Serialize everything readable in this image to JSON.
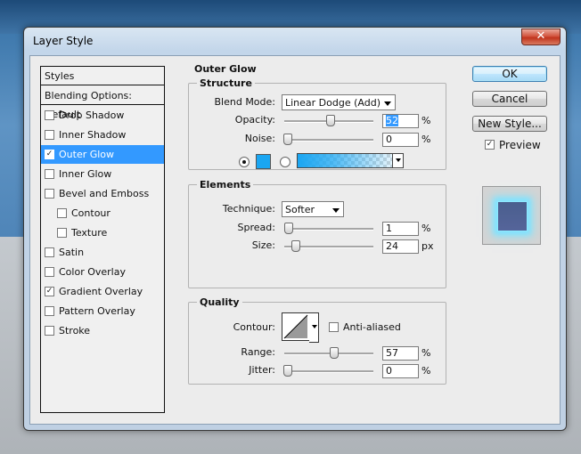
{
  "window": {
    "title": "Layer Style",
    "close_glyph": "✕"
  },
  "styles_list": {
    "header": "Styles",
    "blending_options": "Blending Options: Default",
    "items": [
      {
        "label": "Drop Shadow",
        "checked": false,
        "selected": false,
        "indent": false
      },
      {
        "label": "Inner Shadow",
        "checked": false,
        "selected": false,
        "indent": false
      },
      {
        "label": "Outer Glow",
        "checked": true,
        "selected": true,
        "indent": false
      },
      {
        "label": "Inner Glow",
        "checked": false,
        "selected": false,
        "indent": false
      },
      {
        "label": "Bevel and Emboss",
        "checked": false,
        "selected": false,
        "indent": false
      },
      {
        "label": "Contour",
        "checked": false,
        "selected": false,
        "indent": true
      },
      {
        "label": "Texture",
        "checked": false,
        "selected": false,
        "indent": true
      },
      {
        "label": "Satin",
        "checked": false,
        "selected": false,
        "indent": false
      },
      {
        "label": "Color Overlay",
        "checked": false,
        "selected": false,
        "indent": false
      },
      {
        "label": "Gradient Overlay",
        "checked": true,
        "selected": false,
        "indent": false
      },
      {
        "label": "Pattern Overlay",
        "checked": false,
        "selected": false,
        "indent": false
      },
      {
        "label": "Stroke",
        "checked": false,
        "selected": false,
        "indent": false
      }
    ]
  },
  "outer_glow": {
    "title": "Outer Glow",
    "structure": {
      "title": "Structure",
      "blend_mode_label": "Blend Mode:",
      "blend_mode_value": "Linear Dodge (Add)",
      "opacity_label": "Opacity:",
      "opacity_value": "52",
      "opacity_unit": "%",
      "noise_label": "Noise:",
      "noise_value": "0",
      "noise_unit": "%",
      "color_swatch": "#1aa6f2",
      "color_radio_selected": true,
      "gradient_radio_selected": false
    },
    "elements": {
      "title": "Elements",
      "technique_label": "Technique:",
      "technique_value": "Softer",
      "spread_label": "Spread:",
      "spread_value": "1",
      "spread_unit": "%",
      "size_label": "Size:",
      "size_value": "24",
      "size_unit": "px"
    },
    "quality": {
      "title": "Quality",
      "contour_label": "Contour:",
      "anti_aliased_label": "Anti-aliased",
      "anti_aliased_checked": false,
      "range_label": "Range:",
      "range_value": "57",
      "range_unit": "%",
      "jitter_label": "Jitter:",
      "jitter_value": "0",
      "jitter_unit": "%"
    }
  },
  "buttons": {
    "ok": "OK",
    "cancel": "Cancel",
    "new_style": "New Style..."
  },
  "preview": {
    "label": "Preview",
    "checked": true
  },
  "colors": {
    "selection": "#3399ff",
    "glow": "#7fe3ff"
  }
}
